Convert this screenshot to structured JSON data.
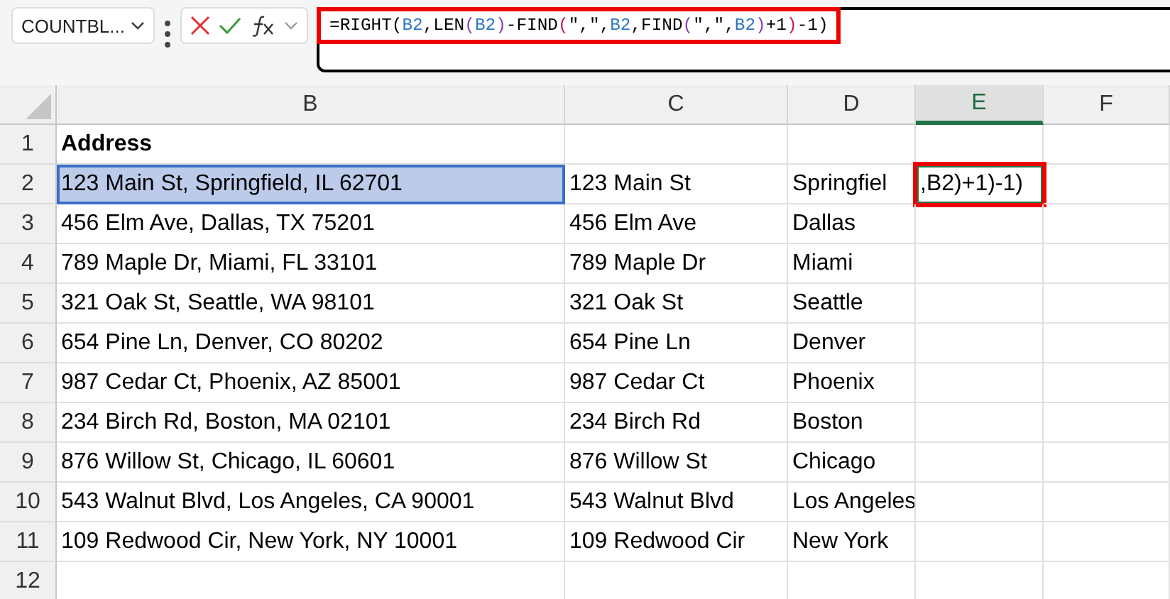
{
  "name_box": {
    "value": "COUNTBL..."
  },
  "formula_bar": {
    "highlight_box": true,
    "tokens": [
      {
        "text": "=RIGHT(",
        "color": "#000000"
      },
      {
        "text": "B2",
        "color": "#2e75c8"
      },
      {
        "text": ",LEN",
        "color": "#000000"
      },
      {
        "text": "(",
        "color": "#8a3fb0"
      },
      {
        "text": "B2",
        "color": "#2e75c8"
      },
      {
        "text": ")",
        "color": "#8a3fb0"
      },
      {
        "text": "-FIND",
        "color": "#000000"
      },
      {
        "text": "(",
        "color": "#c2185b"
      },
      {
        "text": "\",\",",
        "color": "#000000"
      },
      {
        "text": "B2",
        "color": "#2e75c8"
      },
      {
        "text": ",FIND",
        "color": "#000000"
      },
      {
        "text": "(",
        "color": "#8a3fb0"
      },
      {
        "text": "\",\",",
        "color": "#000000"
      },
      {
        "text": "B2",
        "color": "#2e75c8"
      },
      {
        "text": ")",
        "color": "#8a3fb0"
      },
      {
        "text": "+1",
        "color": "#000000"
      },
      {
        "text": ")",
        "color": "#c2185b"
      },
      {
        "text": "-1)",
        "color": "#000000"
      }
    ]
  },
  "columns": [
    {
      "label": "B",
      "selected": false
    },
    {
      "label": "C",
      "selected": false
    },
    {
      "label": "D",
      "selected": false
    },
    {
      "label": "E",
      "selected": true
    },
    {
      "label": "F",
      "selected": false
    }
  ],
  "rows": [
    {
      "number": "1",
      "cells": [
        {
          "text": "Address",
          "bold": true
        },
        {
          "text": ""
        },
        {
          "text": ""
        },
        {
          "text": ""
        },
        {
          "text": ""
        }
      ]
    },
    {
      "number": "2",
      "cells": [
        {
          "text": "123 Main St, Springfield, IL 62701",
          "referenced": true
        },
        {
          "text": "123 Main St"
        },
        {
          "text": "Springfiel"
        },
        {
          "text": ",B2)+1)-1)",
          "editing": true,
          "highlight_box": true
        },
        {
          "text": ""
        }
      ]
    },
    {
      "number": "3",
      "cells": [
        {
          "text": "456 Elm Ave, Dallas, TX 75201"
        },
        {
          "text": "456 Elm Ave"
        },
        {
          "text": "Dallas"
        },
        {
          "text": ""
        },
        {
          "text": ""
        }
      ]
    },
    {
      "number": "4",
      "cells": [
        {
          "text": "789 Maple Dr, Miami, FL 33101"
        },
        {
          "text": "789 Maple Dr"
        },
        {
          "text": "Miami"
        },
        {
          "text": ""
        },
        {
          "text": ""
        }
      ]
    },
    {
      "number": "5",
      "cells": [
        {
          "text": "321 Oak St, Seattle, WA 98101"
        },
        {
          "text": "321 Oak St"
        },
        {
          "text": "Seattle"
        },
        {
          "text": ""
        },
        {
          "text": ""
        }
      ]
    },
    {
      "number": "6",
      "cells": [
        {
          "text": "654 Pine Ln, Denver, CO 80202"
        },
        {
          "text": "654 Pine Ln"
        },
        {
          "text": "Denver"
        },
        {
          "text": ""
        },
        {
          "text": ""
        }
      ]
    },
    {
      "number": "7",
      "cells": [
        {
          "text": "987 Cedar Ct, Phoenix, AZ 85001"
        },
        {
          "text": "987 Cedar Ct"
        },
        {
          "text": "Phoenix"
        },
        {
          "text": ""
        },
        {
          "text": ""
        }
      ]
    },
    {
      "number": "8",
      "cells": [
        {
          "text": "234 Birch Rd, Boston, MA 02101"
        },
        {
          "text": "234 Birch Rd"
        },
        {
          "text": "Boston"
        },
        {
          "text": ""
        },
        {
          "text": ""
        }
      ]
    },
    {
      "number": "9",
      "cells": [
        {
          "text": "876 Willow St, Chicago, IL 60601"
        },
        {
          "text": "876 Willow St"
        },
        {
          "text": "Chicago"
        },
        {
          "text": ""
        },
        {
          "text": ""
        }
      ]
    },
    {
      "number": "10",
      "cells": [
        {
          "text": "543 Walnut Blvd, Los Angeles, CA 90001"
        },
        {
          "text": "543 Walnut Blvd"
        },
        {
          "text": "Los Angeles"
        },
        {
          "text": ""
        },
        {
          "text": ""
        }
      ]
    },
    {
      "number": "11",
      "cells": [
        {
          "text": "109 Redwood Cir, New York, NY 10001"
        },
        {
          "text": "109 Redwood Cir"
        },
        {
          "text": "New York"
        },
        {
          "text": ""
        },
        {
          "text": ""
        }
      ]
    },
    {
      "number": "12",
      "cells": [
        {
          "text": ""
        },
        {
          "text": ""
        },
        {
          "text": ""
        },
        {
          "text": ""
        },
        {
          "text": ""
        }
      ]
    }
  ]
}
